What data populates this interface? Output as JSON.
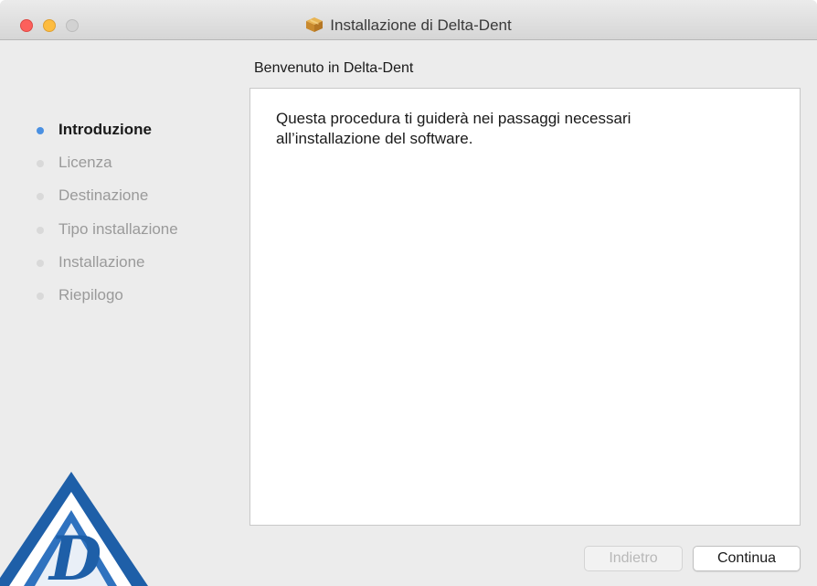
{
  "window": {
    "title": "Installazione di Delta-Dent",
    "title_icon": "package-icon",
    "controls": [
      "close-icon",
      "minimize-icon",
      "zoom-icon"
    ]
  },
  "main": {
    "heading": "Benvenuto in Delta-Dent",
    "body_line1": "Questa procedura ti guiderà nei passaggi necessari",
    "body_line2": "all’installazione del software."
  },
  "sidebar": {
    "steps": [
      {
        "label": "Introduzione",
        "active": true
      },
      {
        "label": "Licenza",
        "active": false
      },
      {
        "label": "Destinazione",
        "active": false
      },
      {
        "label": "Tipo installazione",
        "active": false
      },
      {
        "label": "Installazione",
        "active": false
      },
      {
        "label": "Riepilogo",
        "active": false
      }
    ],
    "logo_icon": "delta-dent-logo",
    "logo_letter": "D"
  },
  "footer": {
    "back_label": "Indietro",
    "back_enabled": false,
    "continue_label": "Continua"
  },
  "colors": {
    "active_bullet": "#4a90e2",
    "close": "#fc605c",
    "minimize": "#fdbc40",
    "zoom_disabled": "#d2d2d2",
    "logo_blue": "#1e5fa8"
  }
}
